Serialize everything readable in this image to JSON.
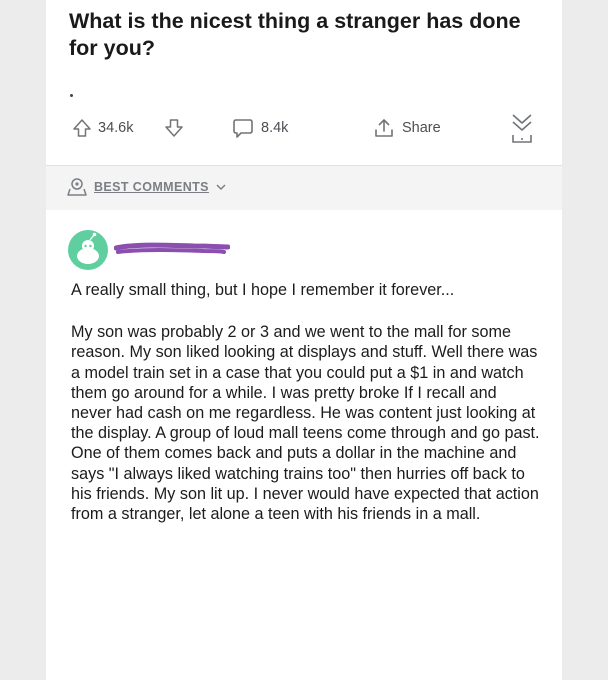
{
  "post": {
    "title": "What is the nicest thing a stranger has done for you?",
    "upvotes": "34.6k",
    "comments": "8.4k",
    "share_label": "Share"
  },
  "sort": {
    "label": "BEST COMMENTS"
  },
  "comment": {
    "paragraph1": "A really small thing, but I hope I remember it forever...",
    "paragraph2": "My son was probably 2 or 3 and we went to the mall for some reason. My son liked looking at displays and stuff. Well there was a model train set in a case that you could put a $1 in and watch them go around for a while. I was pretty broke If I recall and never had cash on me regardless. He was content just looking at the display. A group of loud mall teens come through and go past. One of them comes back and puts a dollar in the machine and says \"I always liked watching trains too\" then hurries off back to his friends. My son lit up. I never would have expected that action from a stranger, let alone a teen with his friends in a mall."
  },
  "colors": {
    "avatar": "#5fcfa0",
    "redaction": "#8b4fb0"
  },
  "icons": [
    "upvote-icon",
    "downvote-icon",
    "comment-icon",
    "share-icon",
    "collapse-icon",
    "sort-icon",
    "chevron-down-icon"
  ]
}
